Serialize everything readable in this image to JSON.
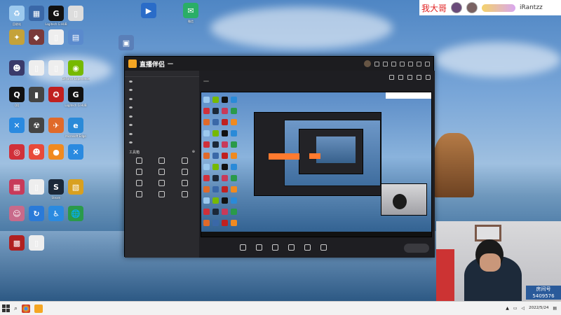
{
  "overlay_top": {
    "red_text": "我大哥",
    "username": "iRantzz"
  },
  "desktop_icons": [
    {
      "label": "回收站",
      "color": "#9cc9ee",
      "glyph": "♻"
    },
    {
      "label": "",
      "color": "#3a68a8",
      "glyph": "▦"
    },
    {
      "label": "Logitech G HUB",
      "color": "#111",
      "glyph": "G"
    },
    {
      "label": "",
      "color": "#ddd",
      "glyph": "▯"
    },
    {
      "label": "",
      "color": "#2a6cc8",
      "glyph": "▶"
    },
    {
      "label": "微信",
      "color": "#2aae67",
      "glyph": "✉"
    },
    {
      "label": "",
      "color": "#5a7fb8",
      "glyph": "▣"
    },
    {
      "label": "",
      "color": "#c4a23a",
      "glyph": "✦"
    },
    {
      "label": "",
      "color": "#7a3a3a",
      "glyph": "◆"
    },
    {
      "label": "",
      "color": "#eee",
      "glyph": "▯"
    },
    {
      "label": "",
      "color": "#5a8acd",
      "glyph": "▤"
    },
    {
      "label": "",
      "color": "#3a3a6a",
      "glyph": "☻"
    },
    {
      "label": "",
      "color": "#eee",
      "glyph": "▯"
    },
    {
      "label": "",
      "color": "#eee",
      "glyph": "▯"
    },
    {
      "label": "GeForce Experience",
      "color": "#76b900",
      "glyph": "◉"
    },
    {
      "label": "QQ",
      "color": "#111",
      "glyph": "Q"
    },
    {
      "label": "",
      "color": "#444",
      "glyph": "▮"
    },
    {
      "label": "",
      "color": "#c02020",
      "glyph": "✪"
    },
    {
      "label": "Logitech G HUB",
      "color": "#111",
      "glyph": "G"
    },
    {
      "label": "",
      "color": "#2a8ae0",
      "glyph": "✕"
    },
    {
      "label": "",
      "color": "#444",
      "glyph": "☢"
    },
    {
      "label": "",
      "color": "#e06a2a",
      "glyph": "✈"
    },
    {
      "label": "Microsoft Edge",
      "color": "#2a8ad8",
      "glyph": "e"
    },
    {
      "label": "",
      "color": "#d0303a",
      "glyph": "◎"
    },
    {
      "label": "",
      "color": "#e84a3a",
      "glyph": "☻"
    },
    {
      "label": "",
      "color": "#f08a20",
      "glyph": "●"
    },
    {
      "label": "",
      "color": "#2a8ae0",
      "glyph": "✕"
    },
    {
      "label": "",
      "color": "#c83a5a",
      "glyph": "▦"
    },
    {
      "label": "",
      "color": "#eee",
      "glyph": "▯"
    },
    {
      "label": "Steam",
      "color": "#1b2838",
      "glyph": "S"
    },
    {
      "label": "",
      "color": "#d8a020",
      "glyph": "▧"
    },
    {
      "label": "",
      "color": "#c86a8a",
      "glyph": "☺"
    },
    {
      "label": "",
      "color": "#2a7ad8",
      "glyph": "↻"
    },
    {
      "label": "",
      "color": "#2a8ae0",
      "glyph": "♿"
    },
    {
      "label": "",
      "color": "#2a9a4a",
      "glyph": "🌐"
    },
    {
      "label": "",
      "color": "#b02020",
      "glyph": "▩"
    },
    {
      "label": "",
      "color": "#eee",
      "glyph": "▯"
    }
  ],
  "app": {
    "title": "直播伴侣",
    "version": "",
    "tabs": [
      "",
      "",
      ""
    ],
    "scenes": [
      "",
      "",
      "",
      "",
      "",
      "",
      "",
      ""
    ],
    "tools_title": "工具箱",
    "tools": [
      "",
      "",
      "",
      "",
      "",
      "",
      "",
      "",
      "",
      "",
      "",
      ""
    ],
    "room_title": "",
    "room_tag": "",
    "room_warn": "",
    "room_category": "",
    "room_online": "",
    "room_likes": "",
    "bottom_tools": [
      "",
      "",
      "",
      "",
      "",
      ""
    ],
    "start_button": "",
    "footer_left": "",
    "footer_status": [
      "",
      "",
      ""
    ]
  },
  "webcam": {
    "logo": "",
    "room_label": "房间号",
    "room_number": "5409576"
  },
  "taskbar": {
    "time": "",
    "date": "2022/5/24"
  }
}
